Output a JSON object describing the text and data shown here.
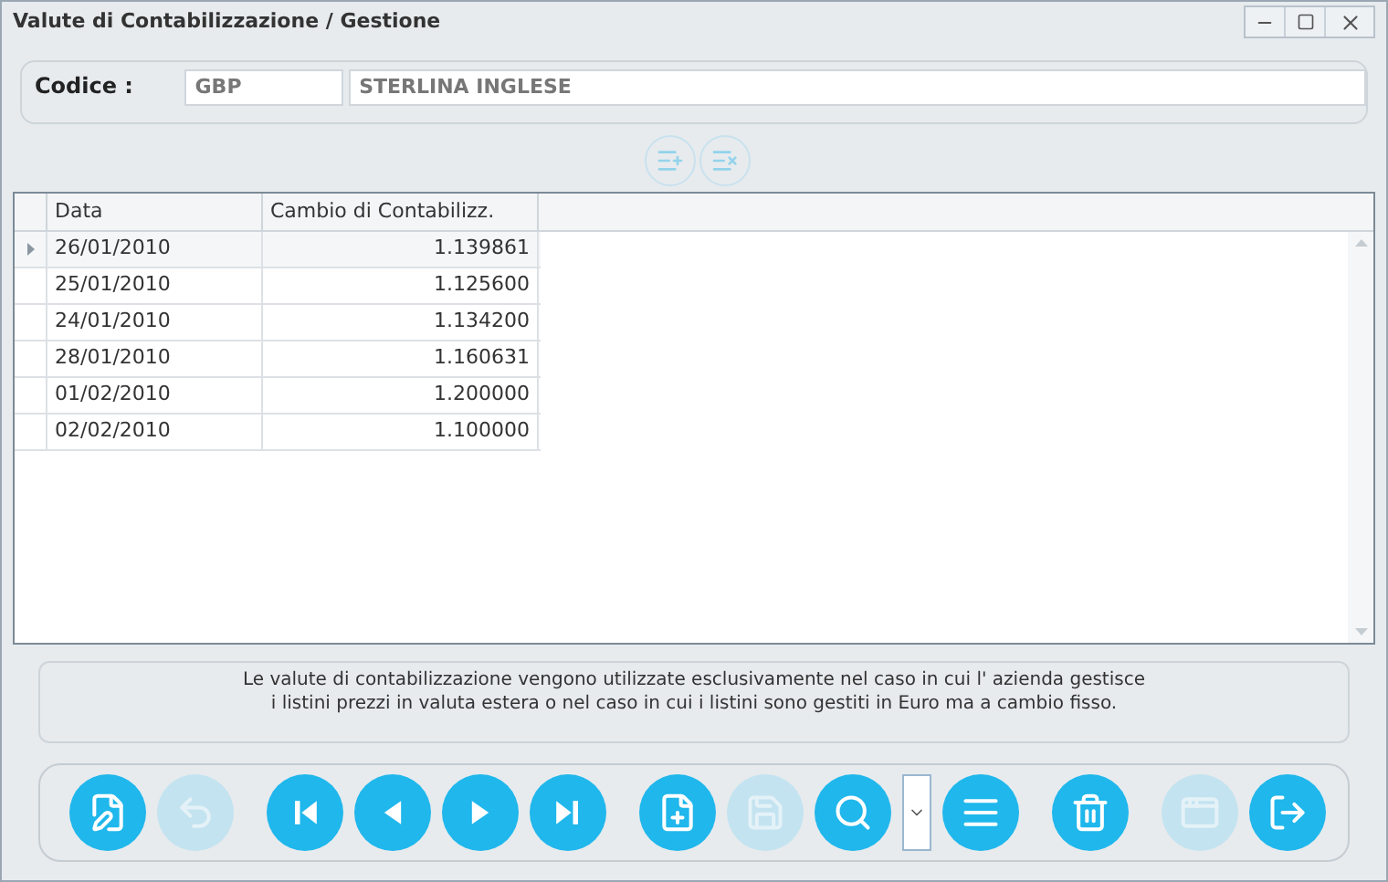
{
  "window": {
    "title": "Valute di Contabilizzazione / Gestione"
  },
  "codice": {
    "label": "Codice :",
    "code": "GBP",
    "description": "STERLINA INGLESE"
  },
  "grid_actions": [
    {
      "kind": "add-row",
      "disabled": true
    },
    {
      "kind": "delete-row",
      "disabled": true
    }
  ],
  "table": {
    "columns": [
      "Data",
      "Cambio di Contabilizz."
    ],
    "rows": [
      {
        "cells": [
          "26/01/2010",
          "1.139861"
        ],
        "selected": true
      },
      {
        "cells": [
          "25/01/2010",
          "1.125600"
        ],
        "selected": false
      },
      {
        "cells": [
          "24/01/2010",
          "1.134200"
        ],
        "selected": false
      },
      {
        "cells": [
          "28/01/2010",
          "1.160631"
        ],
        "selected": false
      },
      {
        "cells": [
          "01/02/2010",
          "1.200000"
        ],
        "selected": false
      },
      {
        "cells": [
          "02/02/2010",
          "1.100000"
        ],
        "selected": false
      }
    ]
  },
  "note": [
    "Le valute di contabilizzazione vengono utilizzate esclusivamente nel caso in cui l' azienda gestisce",
    "i listini prezzi in valuta estera o nel caso in cui i listini sono gestiti in Euro ma a cambio fisso."
  ],
  "toolbar": [
    [
      {
        "kind": "edit",
        "disabled": false
      },
      {
        "kind": "undo",
        "disabled": true
      }
    ],
    [
      {
        "kind": "first",
        "disabled": false
      },
      {
        "kind": "prev",
        "disabled": false
      },
      {
        "kind": "next",
        "disabled": false
      },
      {
        "kind": "last",
        "disabled": false
      }
    ],
    [
      {
        "kind": "new",
        "disabled": false
      },
      {
        "kind": "save",
        "disabled": true
      },
      {
        "kind": "search",
        "disabled": false
      },
      {
        "kind": "dropdown",
        "disabled": false
      },
      {
        "kind": "list",
        "disabled": false
      }
    ],
    [
      {
        "kind": "delete",
        "disabled": false
      }
    ],
    [
      {
        "kind": "window",
        "disabled": true
      },
      {
        "kind": "exit",
        "disabled": false
      }
    ]
  ]
}
